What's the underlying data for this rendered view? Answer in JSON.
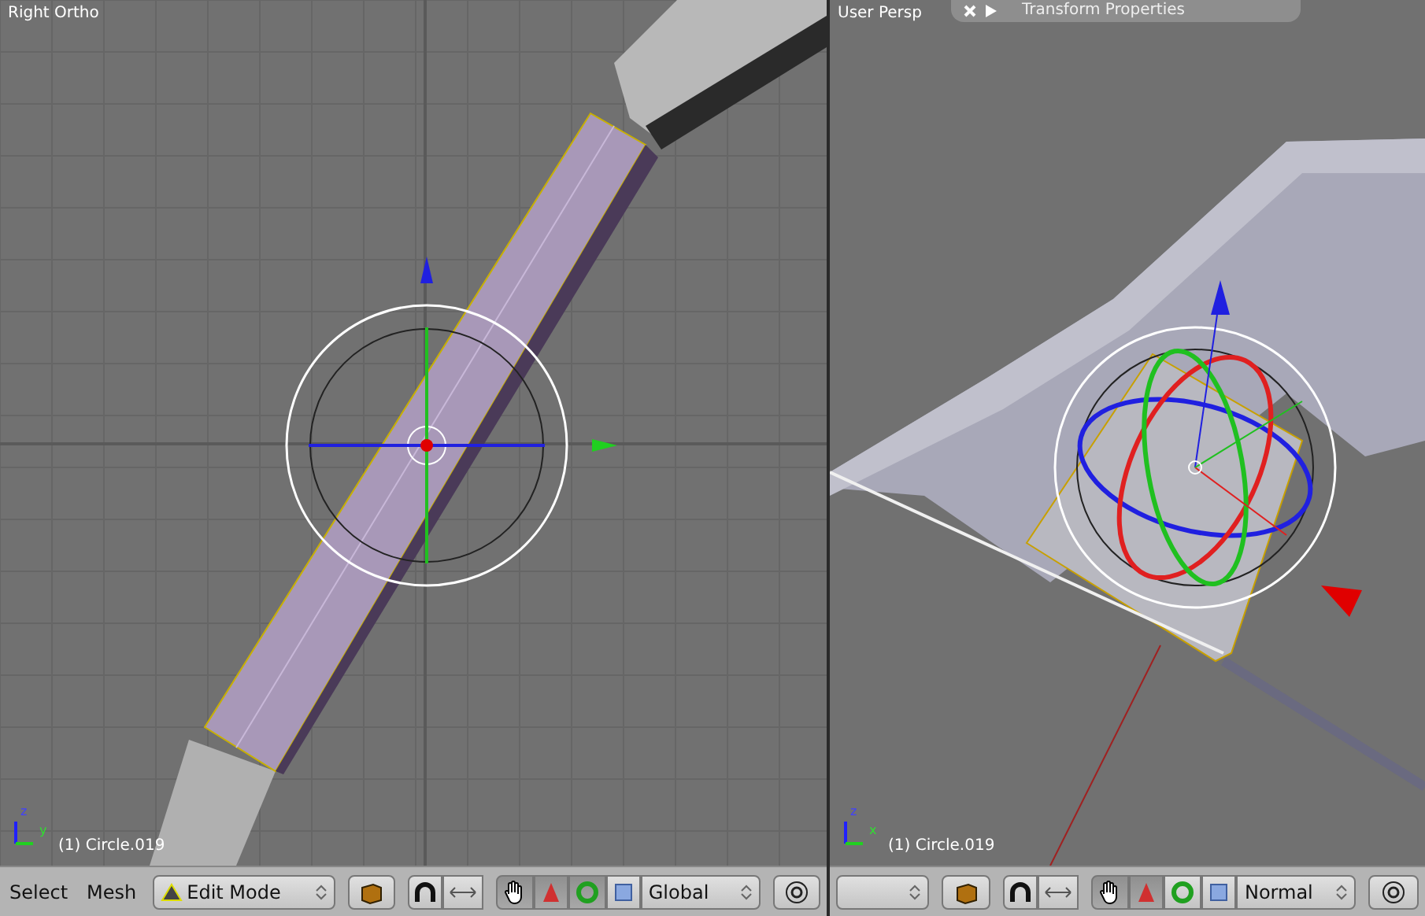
{
  "viewports": [
    {
      "kind": "ortho",
      "title": "Right Ortho",
      "object_label": "(1) Circle.019",
      "axes": [
        "z",
        "y"
      ],
      "header": {
        "menus": [
          "Select",
          "Mesh"
        ],
        "mode": "Edit Mode",
        "orientation": "Global",
        "tools": [
          {
            "kind": "hand",
            "on": true
          },
          {
            "kind": "translate",
            "on": true
          },
          {
            "kind": "rotate",
            "on": true
          },
          {
            "kind": "scale",
            "on": false
          }
        ]
      }
    },
    {
      "kind": "persp",
      "title": "User Persp",
      "object_label": "(1) Circle.019",
      "axes": [
        "z",
        "x"
      ],
      "panel": "Transform Properties",
      "header": {
        "orientation": "Normal",
        "tools": [
          {
            "kind": "hand",
            "on": true
          },
          {
            "kind": "translate",
            "on": true
          },
          {
            "kind": "rotate",
            "on": false
          },
          {
            "kind": "scale",
            "on": false
          }
        ]
      }
    }
  ]
}
